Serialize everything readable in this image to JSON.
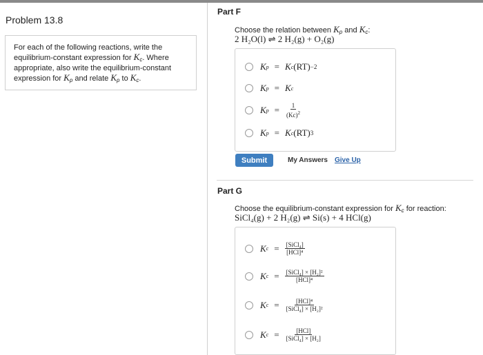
{
  "left": {
    "problem_title": "Problem 13.8",
    "intro": {
      "l1": "For each of the following reactions, write the",
      "l2a": "equilibrium-constant expression for ",
      "l2b": ". Where",
      "l3": "appropriate, also write the equilibrium-constant",
      "l4a": "expression for ",
      "l4b": " and relate ",
      "l4c": " to ",
      "l4d": ".",
      "kc": "K",
      "c": "c",
      "kp": "K",
      "p": "p"
    }
  },
  "partF": {
    "title": "Part F",
    "question_a": "Choose the relation between ",
    "question_b": " and ",
    "question_c": ":",
    "reaction": "2 H₂O(l)  ⇌  2 H₂(g)  +  O₂(g)",
    "options": [
      {
        "lhs": "Kp",
        "rhs": "Kc(RT)",
        "exp": "−2"
      },
      {
        "lhs": "Kp",
        "rhs": "Kc",
        "exp": ""
      },
      {
        "lhs": "Kp",
        "frac_num": "1",
        "frac_den": "(Kc)",
        "frac_exp": "2"
      },
      {
        "lhs": "Kp",
        "rhs": "Kc(RT)",
        "exp": "3"
      }
    ],
    "submit_label": "Submit",
    "my_answers_label": "My Answers",
    "give_up_label": "Give Up"
  },
  "partG": {
    "title": "Part G",
    "question": "Choose the equilibrium-constant expression for ",
    "question_tail": " for reaction:",
    "reaction": "SiCl₄(g) + 2 H₂(g)  ⇌  Si(s)  +  4 HCl(g)",
    "options": [
      {
        "lhs": "Kc",
        "num": "[SiCl₄]",
        "den": "[HCl]⁴"
      },
      {
        "lhs": "Kc",
        "num": "[SiCl₄] × [H₂]²",
        "den": "[HCl]⁴"
      },
      {
        "lhs": "Kc",
        "num": "[HCl]⁴",
        "den": "[SiCl₄] × [H₂]²"
      },
      {
        "lhs": "Kc",
        "num": "[HCl]",
        "den": "[SiCl₄] × [H₂]"
      }
    ]
  },
  "colors": {
    "submit": "#3f7fc0",
    "link": "#2a62a8",
    "text": "#222222",
    "border": "#cfcfcf"
  }
}
